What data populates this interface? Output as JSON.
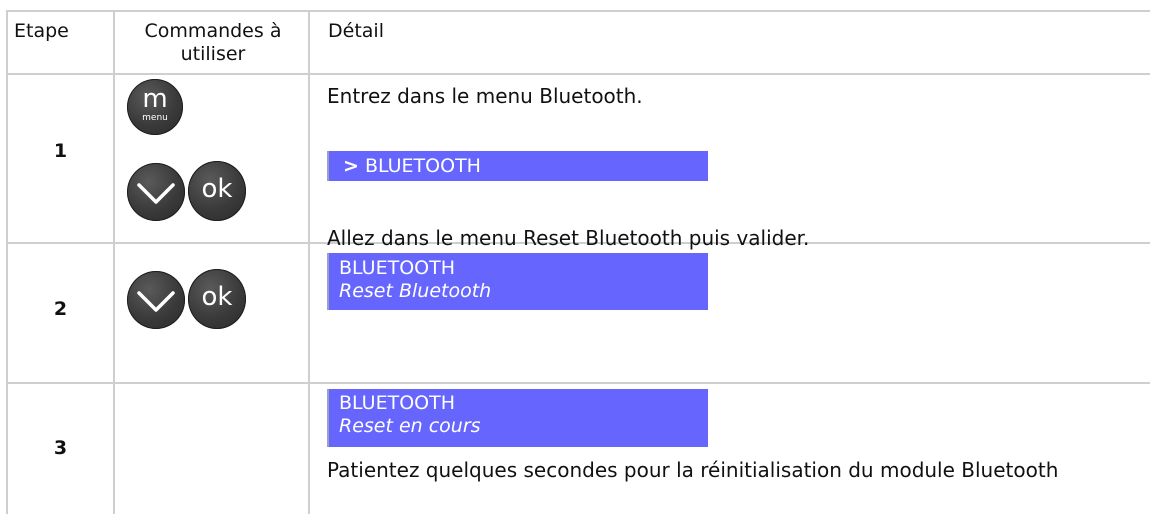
{
  "table": {
    "headers": {
      "step": "Etape",
      "commands": "Commandes à utiliser",
      "detail": "Détail"
    },
    "rows": [
      {
        "step": "1",
        "detail": "Entrez dans le menu Bluetooth.",
        "display": {
          "cursor": ">",
          "line1": "BLUETOOTH"
        },
        "buttons": [
          "menu",
          "down",
          "ok"
        ]
      },
      {
        "step": "2",
        "detail": "Allez dans le menu Reset Bluetooth puis valider.",
        "display": {
          "line1": "BLUETOOTH",
          "line2": "Reset Bluetooth"
        },
        "buttons": [
          "down",
          "ok"
        ]
      },
      {
        "step": "3",
        "detail": "Patientez quelques secondes pour la réinitialisation du module Bluetooth",
        "display": {
          "line1": "BLUETOOTH",
          "line2": "Reset en cours"
        },
        "buttons": []
      }
    ],
    "button_labels": {
      "menu_m": "m",
      "menu_text": "menu",
      "ok": "ok"
    }
  },
  "colors": {
    "lcd_background": "#6666ff",
    "lcd_text": "#ffffff",
    "button_fill": "#3a3a3a",
    "grid_line": "#cfcfcf"
  }
}
